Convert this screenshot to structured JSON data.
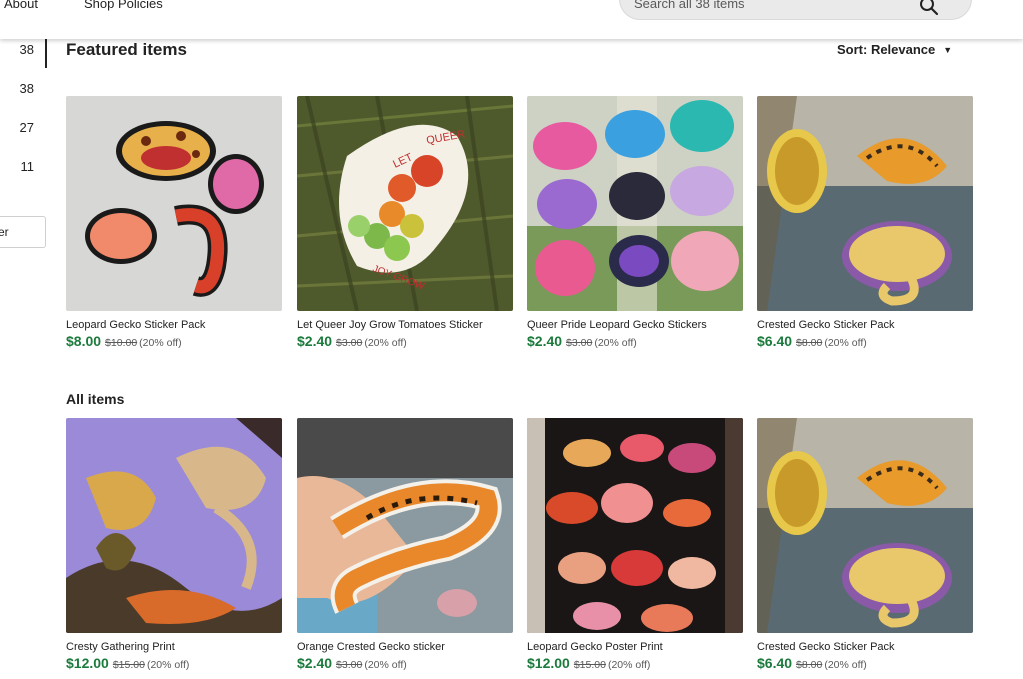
{
  "header": {
    "nav": [
      "About",
      "Shop Policies"
    ],
    "search_placeholder": "Search all 38 items"
  },
  "sidebar": {
    "counts": [
      "38",
      "38",
      "27",
      "11"
    ],
    "box_label": "er"
  },
  "featured": {
    "title": "Featured items",
    "sort_label": "Sort: Relevance",
    "items": [
      {
        "title": "Leopard Gecko Sticker Pack",
        "price": "$8.00",
        "original": "$10.00",
        "discount": "(20% off)"
      },
      {
        "title": "Let Queer Joy Grow Tomatoes Sticker",
        "price": "$2.40",
        "original": "$3.00",
        "discount": "(20% off)"
      },
      {
        "title": "Queer Pride Leopard Gecko Stickers",
        "price": "$2.40",
        "original": "$3.00",
        "discount": "(20% off)"
      },
      {
        "title": "Crested Gecko Sticker Pack",
        "price": "$6.40",
        "original": "$8.00",
        "discount": "(20% off)"
      }
    ]
  },
  "all_items": {
    "title": "All items",
    "items": [
      {
        "title": "Cresty Gathering Print",
        "price": "$12.00",
        "original": "$15.00",
        "discount": "(20% off)"
      },
      {
        "title": "Orange Crested Gecko sticker",
        "price": "$2.40",
        "original": "$3.00",
        "discount": "(20% off)"
      },
      {
        "title": "Leopard Gecko Poster Print",
        "price": "$12.00",
        "original": "$15.00",
        "discount": "(20% off)"
      },
      {
        "title": "Crested Gecko Sticker Pack",
        "price": "$6.40",
        "original": "$8.00",
        "discount": "(20% off)"
      }
    ]
  },
  "sticker_text": {
    "let": "LET",
    "queer": "QUEER",
    "joy_grow": "JOY GROW"
  },
  "colors": {
    "price_green": "#1b7a3c",
    "accent_dark": "#222222"
  },
  "icons": [
    "search-icon",
    "caret-down-icon"
  ]
}
